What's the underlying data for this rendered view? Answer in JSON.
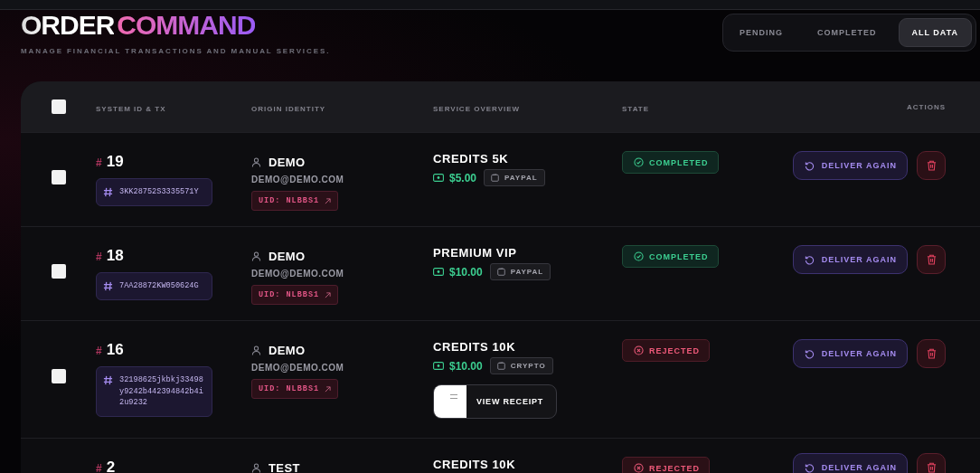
{
  "header": {
    "title_part_1": "ORDER",
    "title_part_2": "COMMAND",
    "subtitle": "MANAGE FINANCIAL TRANSACTIONS AND MANUAL SERVICES."
  },
  "tabs": [
    {
      "label": "PENDING",
      "selected": false
    },
    {
      "label": "COMPLETED",
      "selected": false
    },
    {
      "label": "ALL DATA",
      "selected": true
    }
  ],
  "table": {
    "select_all_checked": false,
    "columns": [
      "SYSTEM ID & TX",
      "ORIGIN IDENTITY",
      "SERVICE OVERVIEW",
      "STATE",
      "ACTIONS"
    ],
    "rows": [
      {
        "checked": false,
        "id_mark": "#",
        "id": "19",
        "tx": "3KK28752S3335571Y",
        "name": "DEMO",
        "email": "DEMO@DEMO.COM",
        "uid": "UID: NLBBS1",
        "service": "CREDITS 5K",
        "amount": "$5.00",
        "method": "PAYPAL",
        "state": {
          "kind": "completed",
          "label": "COMPLETED"
        },
        "action": "DELIVER AGAIN"
      },
      {
        "checked": false,
        "id_mark": "#",
        "id": "18",
        "tx": "7AA28872KW050624G",
        "name": "DEMO",
        "email": "DEMO@DEMO.COM",
        "uid": "UID: NLBBS1",
        "service": "PREMIUM VIP",
        "amount": "$10.00",
        "method": "PAYPAL",
        "state": {
          "kind": "completed",
          "label": "COMPLETED"
        },
        "action": "DELIVER AGAIN"
      },
      {
        "checked": false,
        "id_mark": "#",
        "id": "16",
        "tx": "32198625jkbkj33498y9242b442394842b4i2u9232",
        "name": "DEMO",
        "email": "DEMO@DEMO.COM",
        "uid": "UID: NLBBS1",
        "service": "CREDITS 10K",
        "amount": "$10.00",
        "method": "CRYPTO",
        "receipt": "VIEW RECEIPT",
        "state": {
          "kind": "rejected",
          "label": "REJECTED"
        },
        "action": "DELIVER AGAIN"
      },
      {
        "id_mark": "#",
        "id": "2",
        "name": "TEST",
        "service": "CREDITS 10K",
        "state": {
          "kind": "rejected",
          "label": "REJECTED"
        },
        "action": "DELIVER AGAIN"
      }
    ]
  }
}
